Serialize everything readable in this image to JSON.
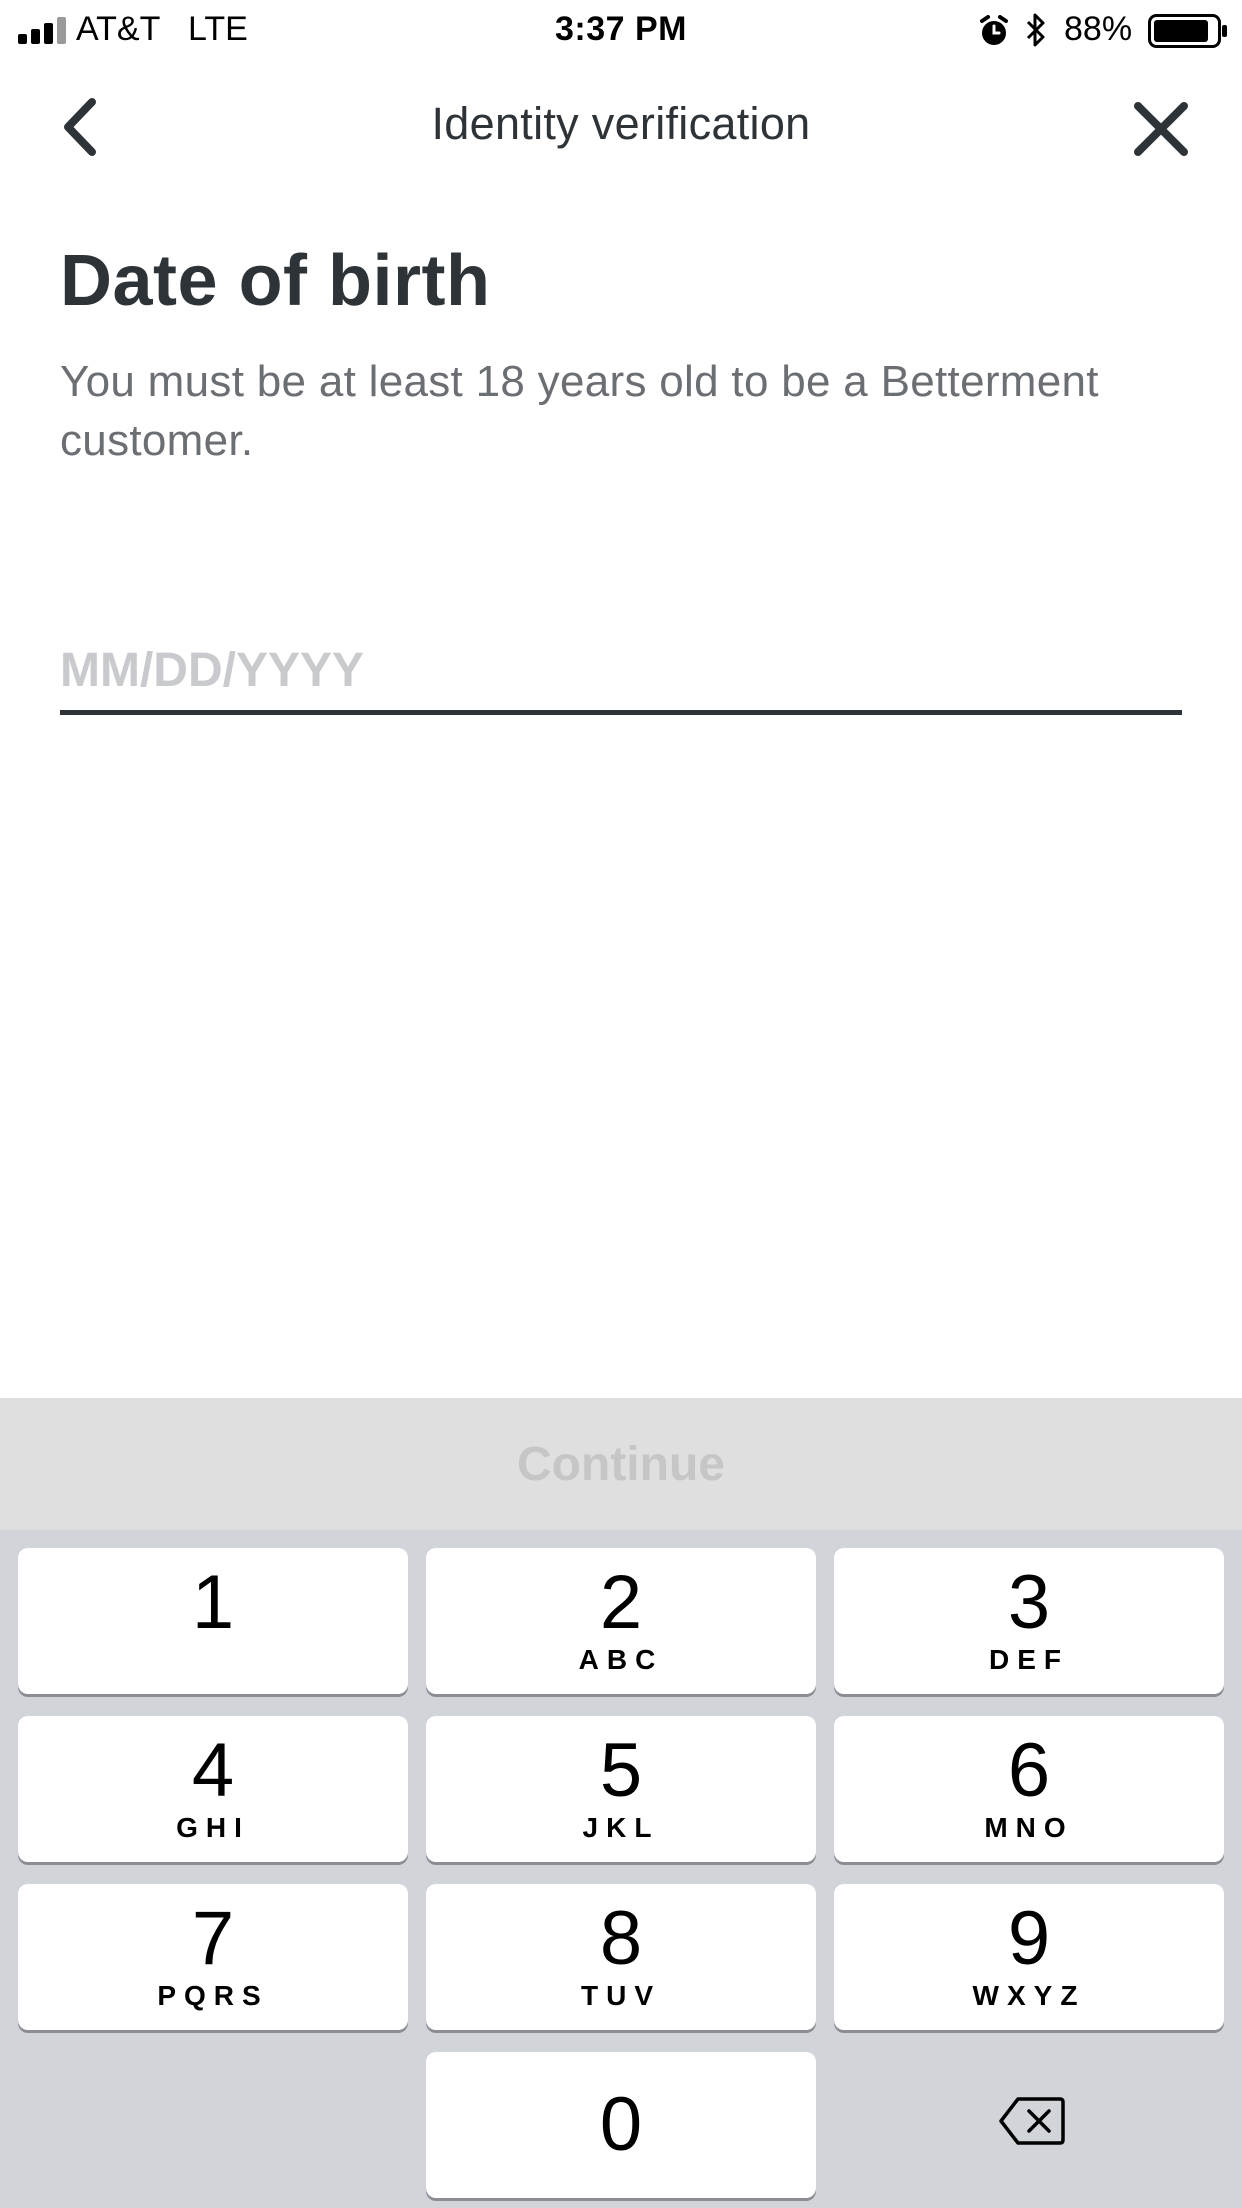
{
  "status_bar": {
    "carrier": "AT&T",
    "network": "LTE",
    "time": "3:37 PM",
    "battery_percent": "88%",
    "battery_level": 0.88,
    "icons": [
      "signal-icon",
      "alarm-icon",
      "bluetooth-icon",
      "battery-icon"
    ]
  },
  "nav": {
    "title": "Identity verification",
    "back_icon": "chevron-left-icon",
    "close_icon": "close-icon"
  },
  "form": {
    "title": "Date of birth",
    "subtitle": "You must be at least 18 years old to be a Betterment customer.",
    "dob_placeholder": "MM/DD/YYYY",
    "dob_value": ""
  },
  "continue_label": "Continue",
  "keypad": {
    "keys": [
      {
        "digit": "1",
        "letters": ""
      },
      {
        "digit": "2",
        "letters": "ABC"
      },
      {
        "digit": "3",
        "letters": "DEF"
      },
      {
        "digit": "4",
        "letters": "GHI"
      },
      {
        "digit": "5",
        "letters": "JKL"
      },
      {
        "digit": "6",
        "letters": "MNO"
      },
      {
        "digit": "7",
        "letters": "PQRS"
      },
      {
        "digit": "8",
        "letters": "TUV"
      },
      {
        "digit": "9",
        "letters": "WXYZ"
      },
      {
        "digit": "0",
        "letters": ""
      }
    ],
    "backspace_icon": "backspace-icon"
  },
  "colors": {
    "text_dark": "#2e3338",
    "text_muted": "#6b6e72",
    "placeholder": "#c8cacd",
    "continue_bg": "#dfdfdf",
    "continue_text": "#c6c6c6",
    "keypad_bg": "#d1d4d8"
  }
}
